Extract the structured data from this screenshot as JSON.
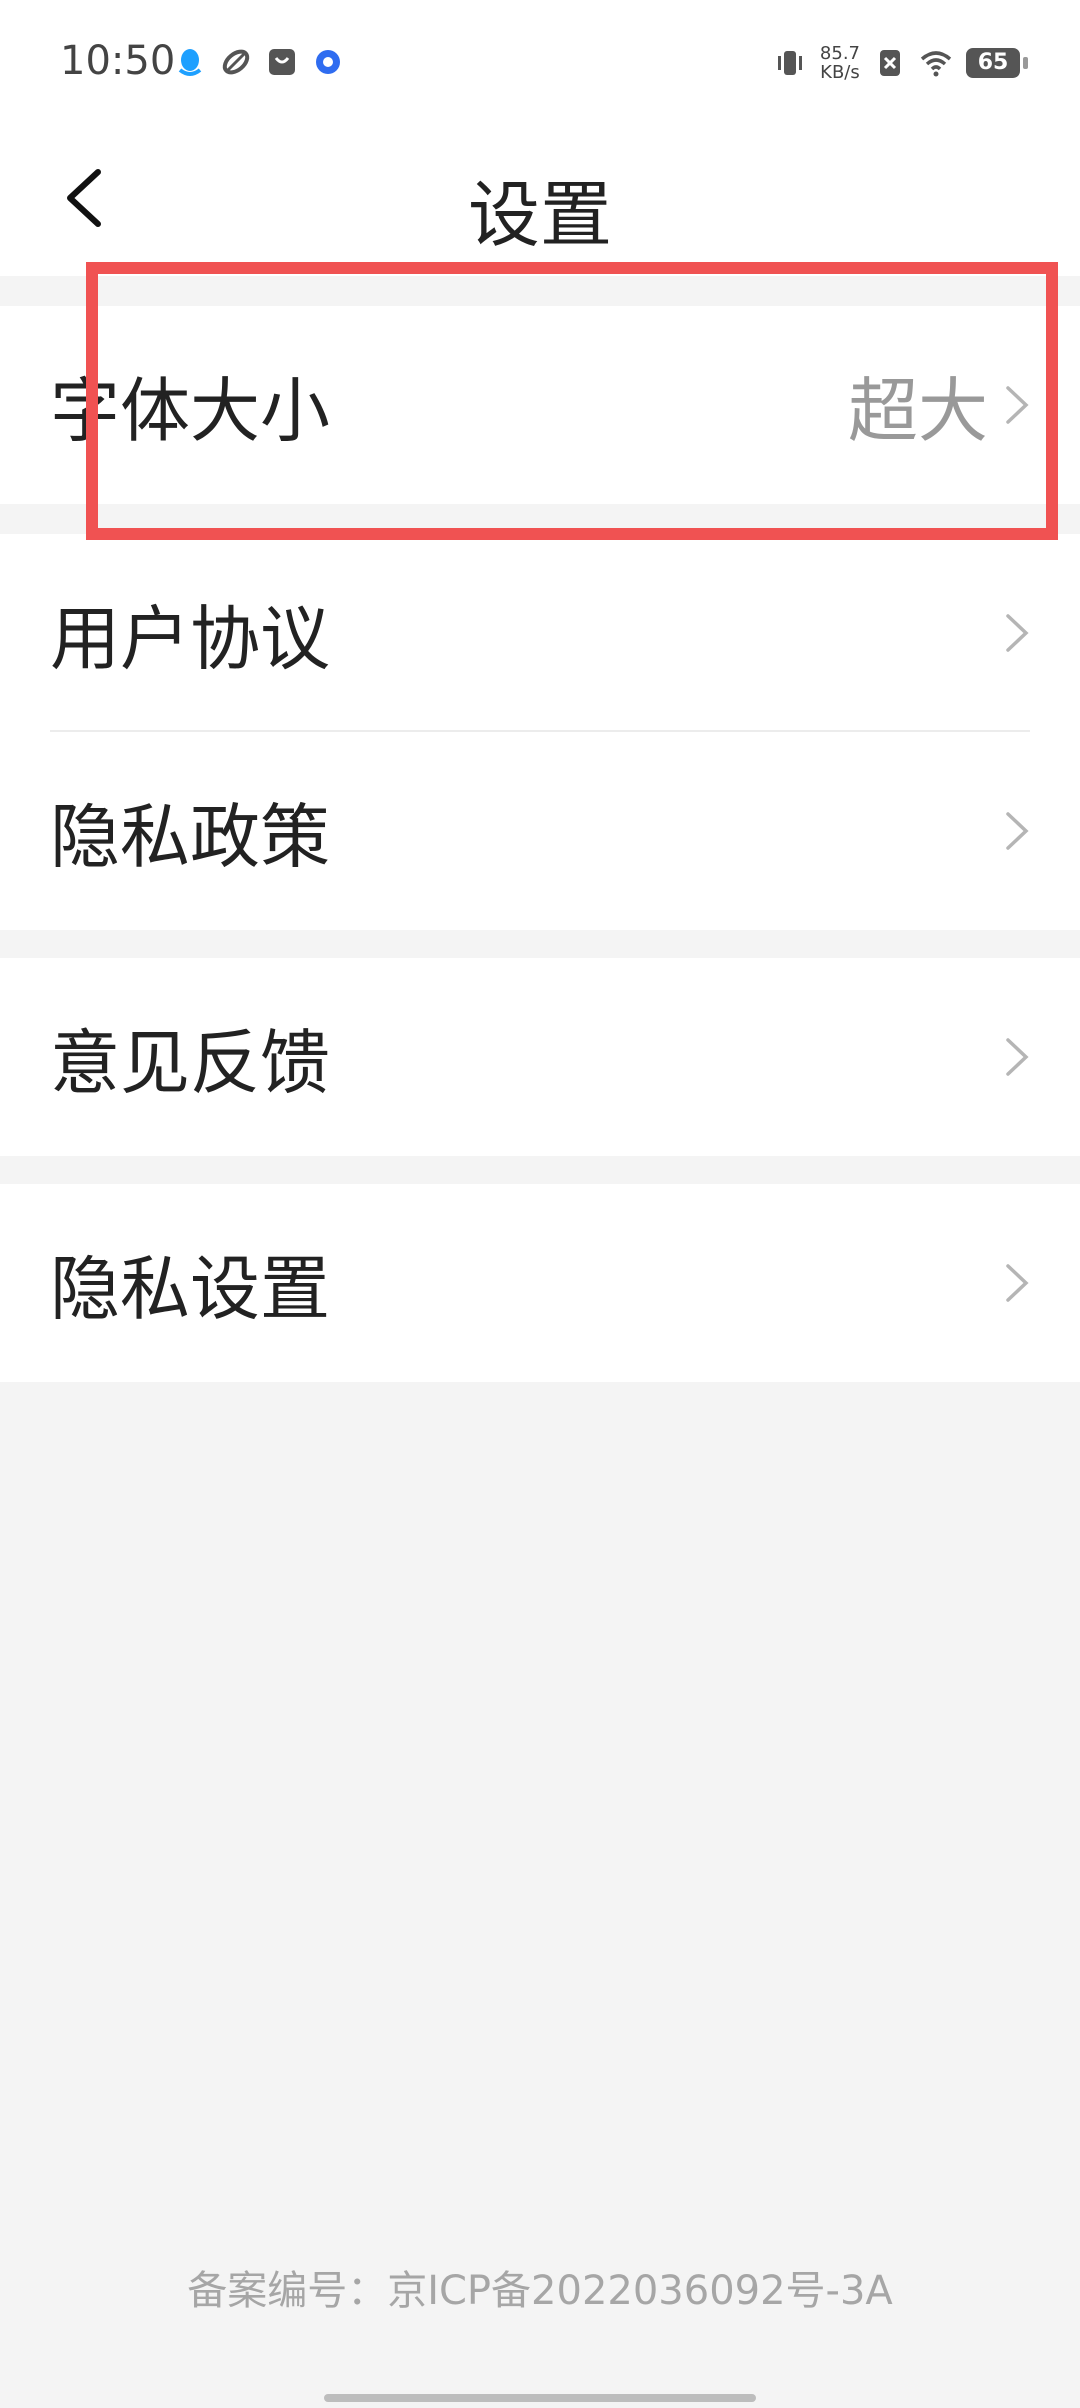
{
  "status_bar": {
    "time": "10:50",
    "net_speed_value": "85.7",
    "net_speed_unit": "KB/s",
    "battery": "65"
  },
  "header": {
    "title": "设置"
  },
  "groups": [
    {
      "items": [
        {
          "label": "字体大小",
          "value": "超大"
        }
      ]
    },
    {
      "items": [
        {
          "label": "用户协议"
        },
        {
          "label": "隐私政策"
        }
      ]
    },
    {
      "items": [
        {
          "label": "意见反馈"
        }
      ]
    },
    {
      "items": [
        {
          "label": "隐私设置"
        }
      ]
    }
  ],
  "footer": {
    "icp": "备案编号：京ICP备2022036092号-3A"
  },
  "colors": {
    "highlight": "#f05252",
    "background": "#f4f4f4",
    "text_primary": "#222222",
    "text_secondary": "#999999"
  }
}
